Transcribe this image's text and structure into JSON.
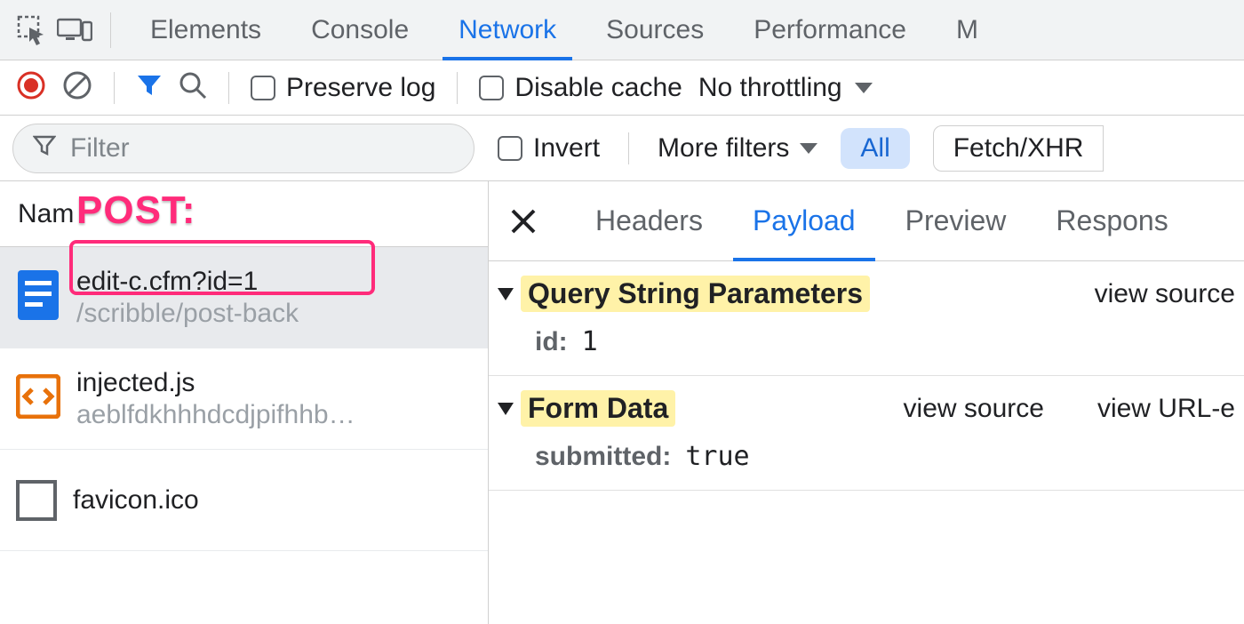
{
  "top_tabs": {
    "items": [
      "Elements",
      "Console",
      "Network",
      "Sources",
      "Performance",
      "M"
    ],
    "active_index": 2
  },
  "toolbar": {
    "preserve_log": "Preserve log",
    "disable_cache": "Disable cache",
    "throttling": "No throttling"
  },
  "filterbar": {
    "filter_placeholder": "Filter",
    "invert": "Invert",
    "more_filters": "More filters",
    "pill_all": "All",
    "seg_fetch": "Fetch/XHR"
  },
  "annotation": {
    "label": "POST:"
  },
  "requests": {
    "header": "Nam",
    "rows": [
      {
        "name": "edit-c.cfm?id=1",
        "sub": "/scribble/post-back",
        "icon": "doc",
        "selected": true
      },
      {
        "name": "injected.js",
        "sub": "aeblfdkhhhdcdjpifhhb…",
        "icon": "script",
        "selected": false
      },
      {
        "name": "favicon.ico",
        "sub": "",
        "icon": "box",
        "selected": false
      }
    ]
  },
  "detail_tabs": {
    "items": [
      "Headers",
      "Payload",
      "Preview",
      "Respons"
    ],
    "active_index": 1
  },
  "sections": [
    {
      "title": "Query String Parameters",
      "highlight": true,
      "links": [
        "view source"
      ],
      "rows": [
        {
          "k": "id:",
          "v": "1"
        }
      ]
    },
    {
      "title": "Form Data",
      "highlight": true,
      "links": [
        "view source",
        "view URL-e"
      ],
      "rows": [
        {
          "k": "submitted:",
          "v": "true"
        }
      ]
    }
  ]
}
